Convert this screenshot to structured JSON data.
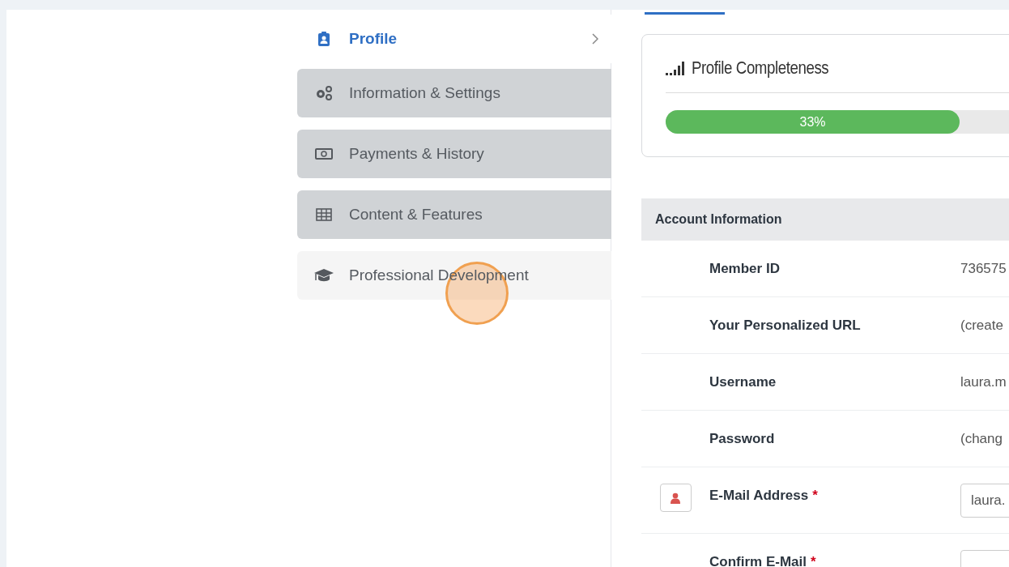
{
  "sidebar": {
    "items": [
      {
        "label": "Profile",
        "selected": true,
        "hovered": false
      },
      {
        "label": "Information & Settings",
        "selected": false,
        "hovered": false
      },
      {
        "label": "Payments & History",
        "selected": false,
        "hovered": false
      },
      {
        "label": "Content & Features",
        "selected": false,
        "hovered": false
      },
      {
        "label": "Professional Development",
        "selected": false,
        "hovered": true
      }
    ]
  },
  "completeness": {
    "title": "Profile Completeness",
    "level": 0.33,
    "reading": "33%"
  },
  "account": {
    "title": "Account Information",
    "rows": [
      {
        "label": "Member ID",
        "value": "736575",
        "kind": "text"
      },
      {
        "label": "Your Personalized URL",
        "value": "(create",
        "kind": "text"
      },
      {
        "label": "Username",
        "value": "laura.m",
        "kind": "text"
      },
      {
        "label": "Password",
        "value": "(chang",
        "kind": "text"
      },
      {
        "label": "E-Mail Address",
        "required_mark": "*",
        "value": "laura.",
        "kind": "icon_field"
      },
      {
        "label": "Confirm E-Mail",
        "required_mark": "*",
        "kind": "field"
      }
    ]
  }
}
